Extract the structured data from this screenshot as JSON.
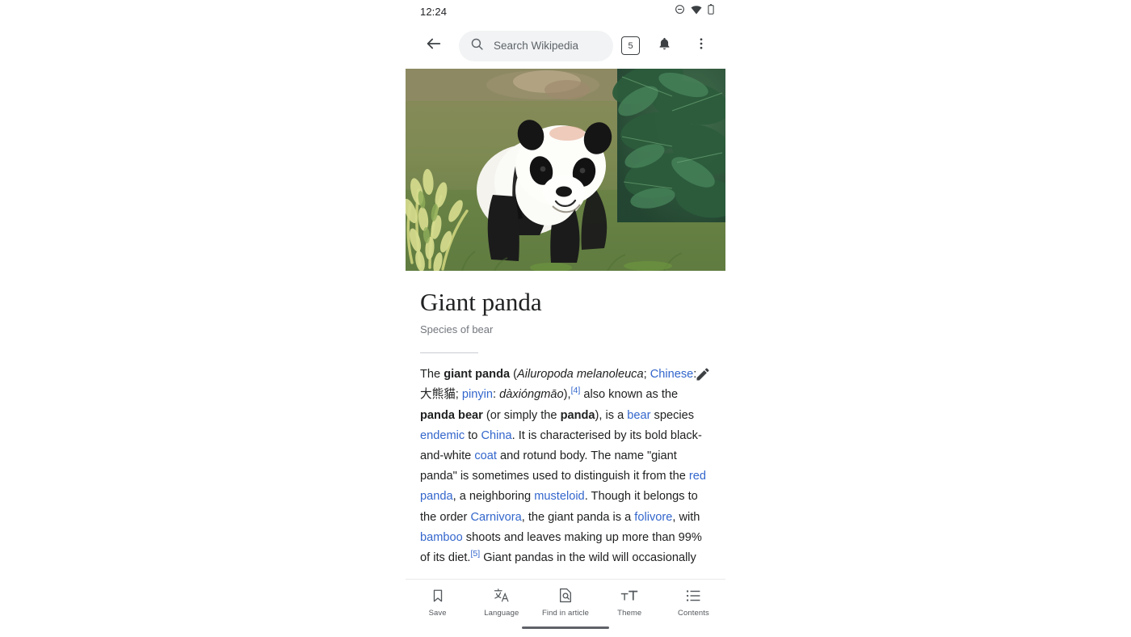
{
  "status_bar": {
    "time": "12:24",
    "icons": [
      "do-not-disturb-icon",
      "wifi-icon",
      "battery-icon"
    ]
  },
  "app_bar": {
    "back_icon": "arrow-back-icon",
    "search_icon": "search-icon",
    "search_placeholder": "Search Wikipedia",
    "tab_count": "5",
    "notifications_icon": "bell-icon",
    "overflow_icon": "more-vertical-icon"
  },
  "hero": {
    "alt": "Giant panda walking on grass beside foliage"
  },
  "article": {
    "title": "Giant panda",
    "description": "Species of bear",
    "edit_icon": "pencil-icon",
    "lead_parts": [
      {
        "t": "The ",
        "s": "plain"
      },
      {
        "t": "giant panda",
        "s": "bold"
      },
      {
        "t": " (",
        "s": "plain"
      },
      {
        "t": "Ailuropoda melanoleuca",
        "s": "italic"
      },
      {
        "t": "; ",
        "s": "plain"
      },
      {
        "t": "Chinese",
        "s": "link"
      },
      {
        "t": ": 大熊貓; ",
        "s": "plain"
      },
      {
        "t": "pinyin",
        "s": "link"
      },
      {
        "t": ": ",
        "s": "plain"
      },
      {
        "t": "dàxióngmāo",
        "s": "italic"
      },
      {
        "t": "),",
        "s": "plain"
      },
      {
        "t": "[4]",
        "s": "ref"
      },
      {
        "t": " also known as the ",
        "s": "plain"
      },
      {
        "t": "panda bear",
        "s": "bold"
      },
      {
        "t": " (or simply the ",
        "s": "plain"
      },
      {
        "t": "panda",
        "s": "bold"
      },
      {
        "t": "), is a ",
        "s": "plain"
      },
      {
        "t": "bear",
        "s": "link"
      },
      {
        "t": " species ",
        "s": "plain"
      },
      {
        "t": "endemic",
        "s": "link"
      },
      {
        "t": " to ",
        "s": "plain"
      },
      {
        "t": "China",
        "s": "link"
      },
      {
        "t": ". It is characterised by its bold black-and-white ",
        "s": "plain"
      },
      {
        "t": "coat",
        "s": "link"
      },
      {
        "t": " and rotund body. The name \"giant panda\" is sometimes used to distinguish it from the ",
        "s": "plain"
      },
      {
        "t": "red panda",
        "s": "link"
      },
      {
        "t": ", a neighboring ",
        "s": "plain"
      },
      {
        "t": "musteloid",
        "s": "link"
      },
      {
        "t": ". Though it belongs to the order ",
        "s": "plain"
      },
      {
        "t": "Carnivora",
        "s": "link"
      },
      {
        "t": ", the giant panda is a ",
        "s": "plain"
      },
      {
        "t": "folivore",
        "s": "link"
      },
      {
        "t": ", with ",
        "s": "plain"
      },
      {
        "t": "bamboo",
        "s": "link"
      },
      {
        "t": " shoots and leaves making up more than 99% of its diet.",
        "s": "plain"
      },
      {
        "t": "[5]",
        "s": "ref"
      },
      {
        "t": " Giant pandas in the wild will occasionally",
        "s": "plain"
      }
    ]
  },
  "bottom_bar": {
    "items": [
      {
        "label": "Save",
        "icon": "bookmark-icon",
        "active": false
      },
      {
        "label": "Language",
        "icon": "translate-icon",
        "active": false
      },
      {
        "label": "Find in article",
        "icon": "find-in-page-icon",
        "active": true
      },
      {
        "label": "Theme",
        "icon": "text-format-icon",
        "active": false
      },
      {
        "label": "Contents",
        "icon": "list-icon",
        "active": false
      }
    ]
  },
  "colors": {
    "link": "#3366cc",
    "text": "#202122",
    "muted": "#72777d",
    "search_bg": "#f1f3f4"
  }
}
